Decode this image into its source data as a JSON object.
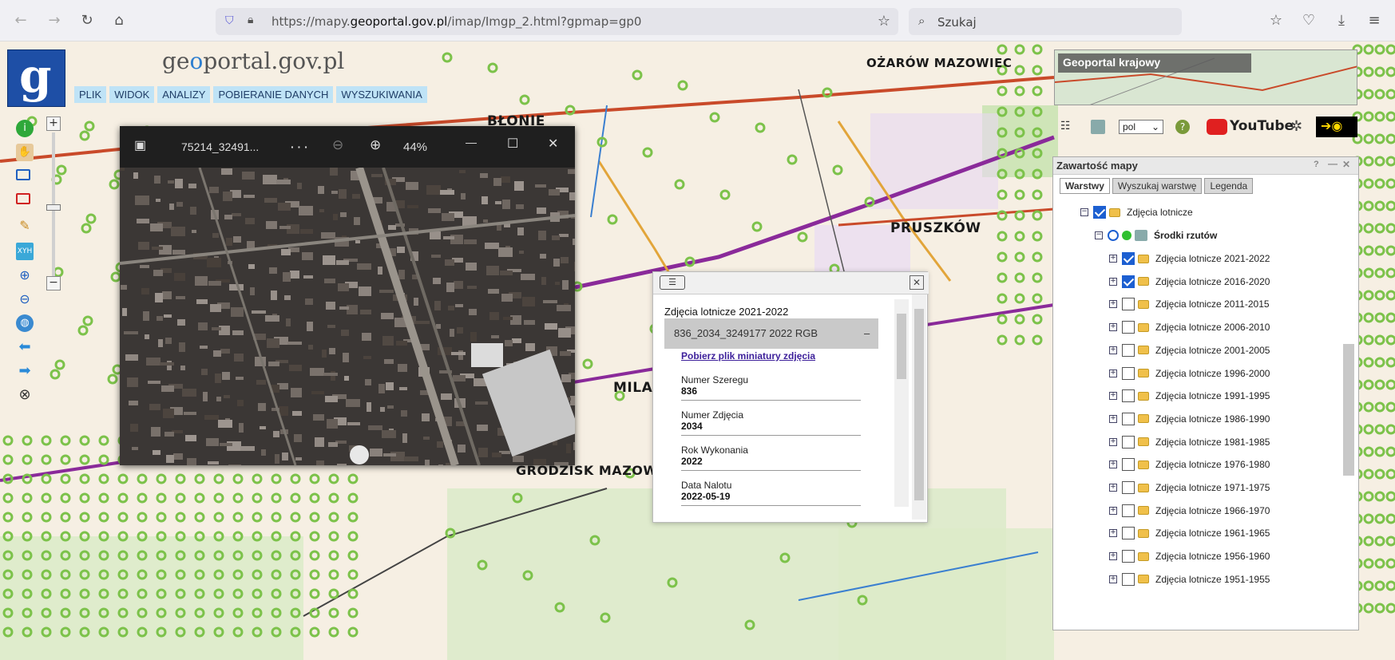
{
  "browser": {
    "url_prefix": "https://mapy.",
    "url_domain": "geoportal.gov.pl",
    "url_path": "/imap/Imgp_2.html?gpmap=gp0",
    "search_placeholder": "Szukaj"
  },
  "site": {
    "logo_text_a": "ge",
    "logo_text_o": "o",
    "logo_text_b": "portal.gov.pl",
    "menu": [
      "PLIK",
      "WIDOK",
      "ANALIZY",
      "POBIERANIE DANYCH",
      "WYSZUKIWANIA"
    ]
  },
  "map_labels": {
    "blonie": "BŁONIE",
    "ozarow": "OŻARÓW MAZOWIEC",
    "pruszkow": "PRUSZKÓW",
    "milan": "MILAN",
    "grodzisk": "GRODZISK MAZOW"
  },
  "viewer": {
    "filename": "75214_32491...",
    "more": "· · ·",
    "zoom": "44%"
  },
  "popup": {
    "title": "Zdjęcia lotnicze 2021-2022",
    "header": "836_2034_3249177 2022 RGB",
    "header_collapse": "–",
    "link": "Pobierz plik miniatury zdjęcia",
    "fields": [
      {
        "label": "Numer Szeregu",
        "value": "836"
      },
      {
        "label": "Numer Zdjęcia",
        "value": "2034"
      },
      {
        "label": "Rok Wykonania",
        "value": "2022"
      },
      {
        "label": "Data Nalotu",
        "value": "2022-05-19"
      }
    ]
  },
  "panel": {
    "overview_label": "Geoportal krajowy",
    "lang": "pol",
    "youtube": "YouTube",
    "title": "Zawartość mapy",
    "tabs": [
      "Warstwy",
      "Wyszukaj warstwę",
      "Legenda"
    ],
    "group": "Zdjęcia lotnicze",
    "subgroup": "Środki rzutów",
    "layers": [
      {
        "label": "Zdjęcia lotnicze 2021-2022",
        "checked": true
      },
      {
        "label": "Zdjęcia lotnicze 2016-2020",
        "checked": true
      },
      {
        "label": "Zdjęcia lotnicze 2011-2015",
        "checked": false
      },
      {
        "label": "Zdjęcia lotnicze 2006-2010",
        "checked": false
      },
      {
        "label": "Zdjęcia lotnicze 2001-2005",
        "checked": false
      },
      {
        "label": "Zdjęcia lotnicze 1996-2000",
        "checked": false
      },
      {
        "label": "Zdjęcia lotnicze 1991-1995",
        "checked": false
      },
      {
        "label": "Zdjęcia lotnicze 1986-1990",
        "checked": false
      },
      {
        "label": "Zdjęcia lotnicze 1981-1985",
        "checked": false
      },
      {
        "label": "Zdjęcia lotnicze 1976-1980",
        "checked": false
      },
      {
        "label": "Zdjęcia lotnicze 1971-1975",
        "checked": false
      },
      {
        "label": "Zdjęcia lotnicze 1966-1970",
        "checked": false
      },
      {
        "label": "Zdjęcia lotnicze 1961-1965",
        "checked": false
      },
      {
        "label": "Zdjęcia lotnicze 1956-1960",
        "checked": false
      },
      {
        "label": "Zdjęcia lotnicze 1951-1955",
        "checked": false
      }
    ]
  },
  "colors": {
    "menu_bg": "#bfe3f6",
    "marker_green": "#7cc24a",
    "road_red": "#c94a2a",
    "rail_purple": "#8a2a9a"
  }
}
